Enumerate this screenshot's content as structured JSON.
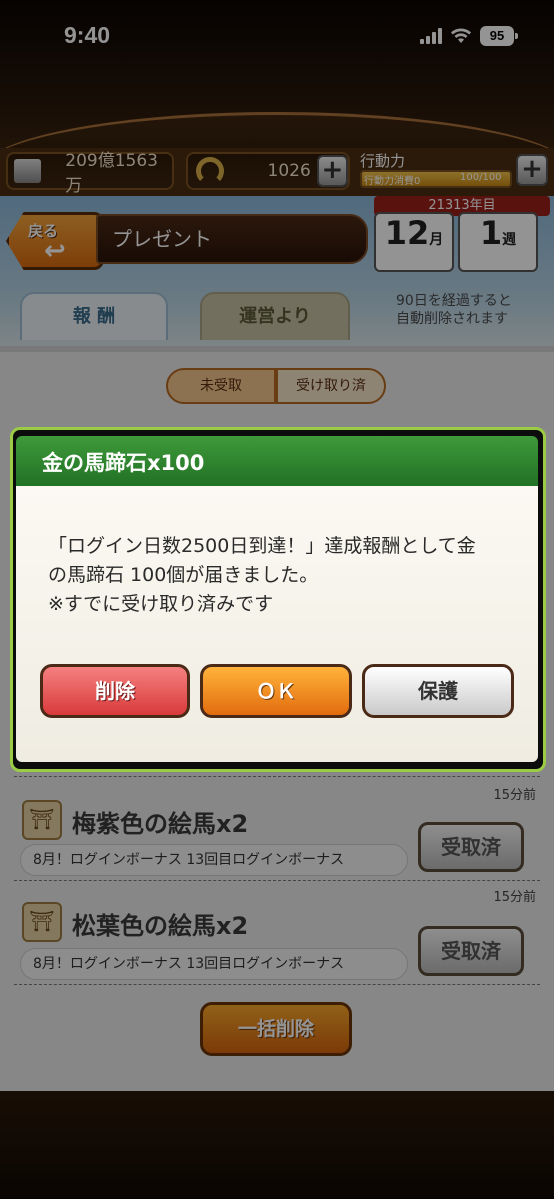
{
  "status_bar": {
    "time": "9:40",
    "battery": "95"
  },
  "resources": {
    "money": "209億1563万",
    "horseshoe": "1026",
    "action_label": "行動力",
    "action_cost": "行動力消費0",
    "action_value": "100/100",
    "action_fill": 1.0
  },
  "header": {
    "back_label": "戻る",
    "title": "プレゼント",
    "year": "21313年目",
    "month_num": "12",
    "month_unit": "月",
    "week_num": "1",
    "week_unit": "週"
  },
  "tabs": [
    {
      "label": "報 酬"
    },
    {
      "label": "運営より"
    }
  ],
  "auto_delete_note": {
    "line1": "90日を経過すると",
    "line2": "自動削除されます"
  },
  "segment": {
    "unreceived": "未受取",
    "received": "受け取り済"
  },
  "items": [
    {
      "time": "15分前",
      "name": "梅紫色の絵馬x2",
      "desc": "8月！ログインボーナス 13回目ログインボーナス",
      "button": "受取済"
    },
    {
      "time": "15分前",
      "name": "松葉色の絵馬x2",
      "desc": "8月！ログインボーナス 13回目ログインボーナス",
      "button": "受取済"
    }
  ],
  "bulk_delete": "一括削除",
  "dialog": {
    "title": "金の馬蹄石x100",
    "line1": "「ログイン日数2500日到達！」達成報酬として金",
    "line2": "の馬蹄石 100個が届きました。",
    "line3": "※すでに受け取り済みです",
    "delete": "削除",
    "ok": "ＯＫ",
    "protect": "保護"
  }
}
